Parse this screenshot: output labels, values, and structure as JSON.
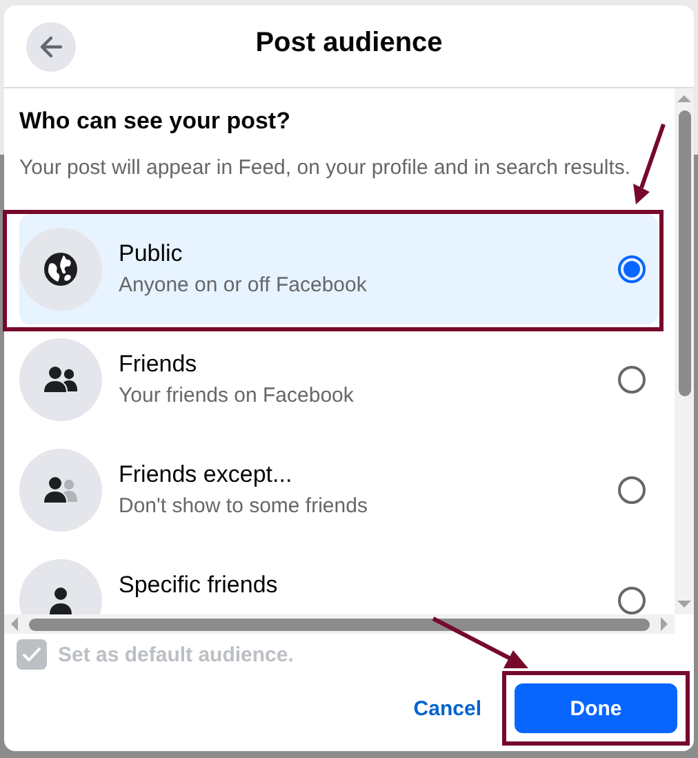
{
  "header": {
    "title": "Post audience"
  },
  "heading": "Who can see your post?",
  "description": "Your post will appear in Feed, on your profile and in search results.",
  "options": [
    {
      "kind": "globe",
      "title": "Public",
      "subtitle": "Anyone on or off Facebook",
      "selected": true
    },
    {
      "kind": "friends",
      "title": "Friends",
      "subtitle": "Your friends on Facebook",
      "selected": false
    },
    {
      "kind": "friends-except",
      "title": "Friends except...",
      "subtitle": "Don't show to some friends",
      "selected": false
    },
    {
      "kind": "person",
      "title": "Specific friends",
      "selected": false
    }
  ],
  "default_checkbox": {
    "label": "Set as default audience.",
    "checked": true,
    "disabled": true
  },
  "buttons": {
    "cancel": "Cancel",
    "done": "Done"
  }
}
